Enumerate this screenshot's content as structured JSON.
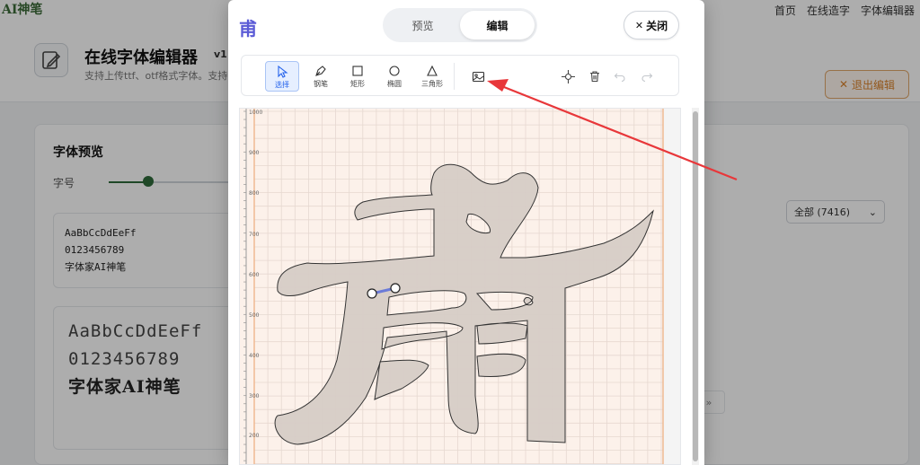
{
  "brand": "AI神笔",
  "topnav": [
    "首页",
    "在线造字",
    "字体编辑器"
  ],
  "header": {
    "title": "在线字体编辑器",
    "version": "v1",
    "subtitle": "支持上传ttf、otf格式字体。支持",
    "exit_label": "退出编辑"
  },
  "left_card": {
    "title": "字体预览",
    "size_label": "字号",
    "sample_small": [
      "AaBbCcDdEeFf",
      "0123456789",
      "字体家AI神笔"
    ],
    "sample_large": [
      "AaBbCcDdEeFf",
      "0123456789",
      "字体家AI神笔"
    ]
  },
  "right_card": {
    "filter_value": "全部 (7416)",
    "pager": "»"
  },
  "modal": {
    "glyph": "甫",
    "tabs": [
      {
        "label": "预览",
        "active": false
      },
      {
        "label": "编辑",
        "active": true
      }
    ],
    "close_label": "关闭",
    "tools": [
      {
        "label": "选择",
        "icon": "pointer-icon",
        "active": true
      },
      {
        "label": "钢笔",
        "icon": "pen-icon",
        "active": false
      },
      {
        "label": "矩形",
        "icon": "rectangle-icon",
        "active": false
      },
      {
        "label": "椭圆",
        "icon": "ellipse-icon",
        "active": false
      },
      {
        "label": "三角形",
        "icon": "triangle-icon",
        "active": false
      }
    ],
    "actions": [
      "image-icon",
      "crosshair-icon",
      "trash-icon",
      "undo-icon",
      "redo-icon"
    ],
    "ruler_ticks": [
      "1000",
      "900",
      "800",
      "700",
      "600",
      "500",
      "400",
      "300",
      "200"
    ]
  },
  "colors": {
    "accent": "#5b5bd6",
    "brand_green": "#2f6b3a",
    "exit_orange": "#d9822b",
    "glyph_fill": "#d6ccc6",
    "annotation_red": "#e8373a"
  }
}
